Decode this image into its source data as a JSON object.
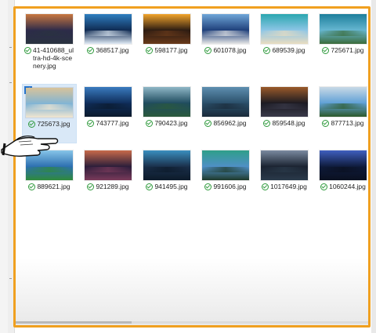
{
  "files": [
    {
      "name": "41-410688_ultra-hd-4k-scenery.jpg",
      "status": "synced",
      "palette": [
        "#2c2a4a",
        "#c8773f",
        "#2a3340"
      ]
    },
    {
      "name": "368517.jpg",
      "status": "synced",
      "palette": [
        "#0f2a52",
        "#2f7fc0",
        "#dfeaf4"
      ]
    },
    {
      "name": "598177.jpg",
      "status": "synced",
      "palette": [
        "#2a1a12",
        "#f2a42b",
        "#6a3a1a"
      ]
    },
    {
      "name": "601078.jpg",
      "status": "synced",
      "palette": [
        "#1e3f7a",
        "#6fa6d8",
        "#e6e6e6"
      ]
    },
    {
      "name": "689539.jpg",
      "status": "synced",
      "palette": [
        "#8ec6e6",
        "#2aa6b0",
        "#e9dcc0"
      ]
    },
    {
      "name": "725671.jpg",
      "status": "synced",
      "palette": [
        "#67b7d1",
        "#1d7f9c",
        "#3a6b3a"
      ]
    },
    {
      "name": "725673.jpg",
      "status": "synced",
      "palette": [
        "#7fb4d6",
        "#d8c39a",
        "#f2e6d0"
      ]
    },
    {
      "name": "743777.jpg",
      "status": "synced",
      "palette": [
        "#0f2d5a",
        "#3a7bbf",
        "#0b1a2c"
      ]
    },
    {
      "name": "790423.jpg",
      "status": "synced",
      "palette": [
        "#1f4b5e",
        "#8fb7c7",
        "#2b5a3c"
      ]
    },
    {
      "name": "856962.jpg",
      "status": "synced",
      "palette": [
        "#2a4f6a",
        "#5e8fb0",
        "#1b2b3a"
      ]
    },
    {
      "name": "859548.jpg",
      "status": "synced",
      "palette": [
        "#1b1a22",
        "#9a5a2a",
        "#3a3a4a"
      ]
    },
    {
      "name": "877713.jpg",
      "status": "synced",
      "palette": [
        "#5fa0d6",
        "#c9d9e6",
        "#2d5a2a"
      ]
    },
    {
      "name": "889621.jpg",
      "status": "synced",
      "palette": [
        "#2c6fb0",
        "#87c5e8",
        "#2f8a3a"
      ]
    },
    {
      "name": "921289.jpg",
      "status": "synced",
      "palette": [
        "#2a1d3a",
        "#c86a4a",
        "#7a3a5a"
      ]
    },
    {
      "name": "941495.jpg",
      "status": "synced",
      "palette": [
        "#1a2f4a",
        "#3a8fbf",
        "#0c1a2a"
      ]
    },
    {
      "name": "991606.jpg",
      "status": "synced",
      "palette": [
        "#4f8fc6",
        "#2f9f8a",
        "#1e3a2a"
      ]
    },
    {
      "name": "1017649.jpg",
      "status": "synced",
      "palette": [
        "#1a2230",
        "#7a8aa0",
        "#2a3a4a"
      ]
    },
    {
      "name": "1060244.jpg",
      "status": "synced",
      "palette": [
        "#0e1a3a",
        "#3f5fbf",
        "#0a1020"
      ]
    }
  ],
  "selected_index": 6,
  "colors": {
    "accent": "#f0a020",
    "sync": "#2f9a3c",
    "selection": "#d9e8f7"
  }
}
